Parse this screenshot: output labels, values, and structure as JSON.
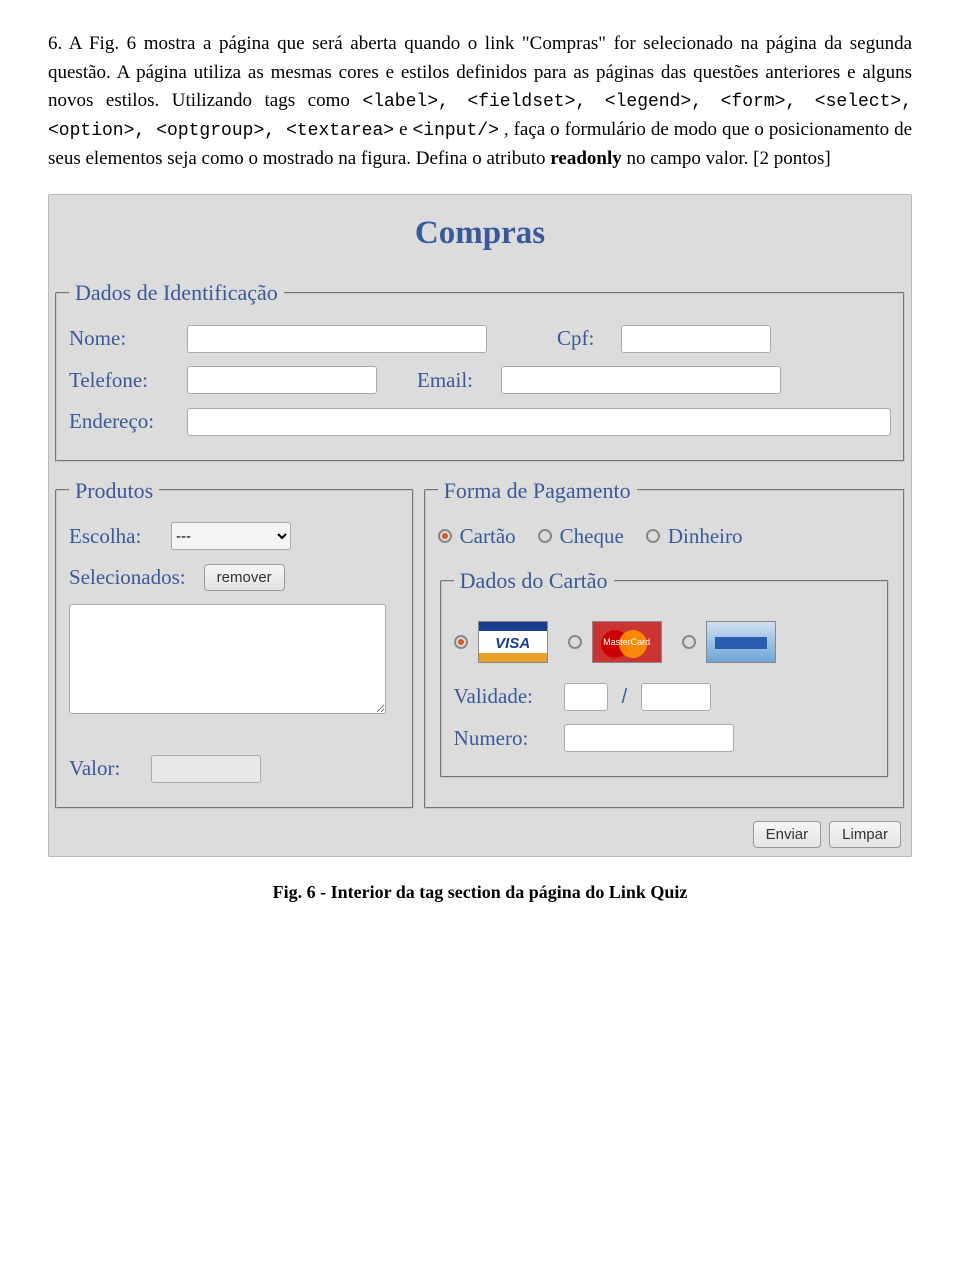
{
  "paragraph": {
    "lead": "6. A Fig. 6 mostra a página que será aberta quando o link \"Compras\" for selecionado na página da segunda questão. A página utiliza as mesmas cores e estilos definidos para as páginas das questões anteriores e alguns novos estilos. Utilizando tags como ",
    "tags": "<label>, <fieldset>, <legend>, <form>, <select>, <option>, <optgroup>, <textarea>",
    "mid": " e ",
    "tag2": "<input/>",
    "tail1": ", faça o formulário de modo que o posicionamento de seus elementos seja como o mostrado na figura. Defina o atributo ",
    "readonly": "readonly",
    "tail2": " no campo valor. [2 pontos]"
  },
  "form": {
    "title": "Compras",
    "id_legend": "Dados de Identificação",
    "nome": "Nome:",
    "cpf": "Cpf:",
    "telefone": "Telefone:",
    "email": "Email:",
    "endereco": "Endereço:",
    "prod_legend": "Produtos",
    "escolha": "Escolha:",
    "select_option": "---",
    "selecionados": "Selecionados:",
    "remover": "remover",
    "valor": "Valor:",
    "pag_legend": "Forma de Pagamento",
    "cartao": "Cartão",
    "cheque": "Cheque",
    "dinheiro": "Dinheiro",
    "dados_cartao": "Dados do Cartão",
    "mastercard_text": "MasterCard",
    "validade": "Validade:",
    "slash": "/",
    "numero": "Numero:",
    "enviar": "Enviar",
    "limpar": "Limpar"
  },
  "caption": "Fig. 6 - Interior da tag section da página do Link Quiz"
}
